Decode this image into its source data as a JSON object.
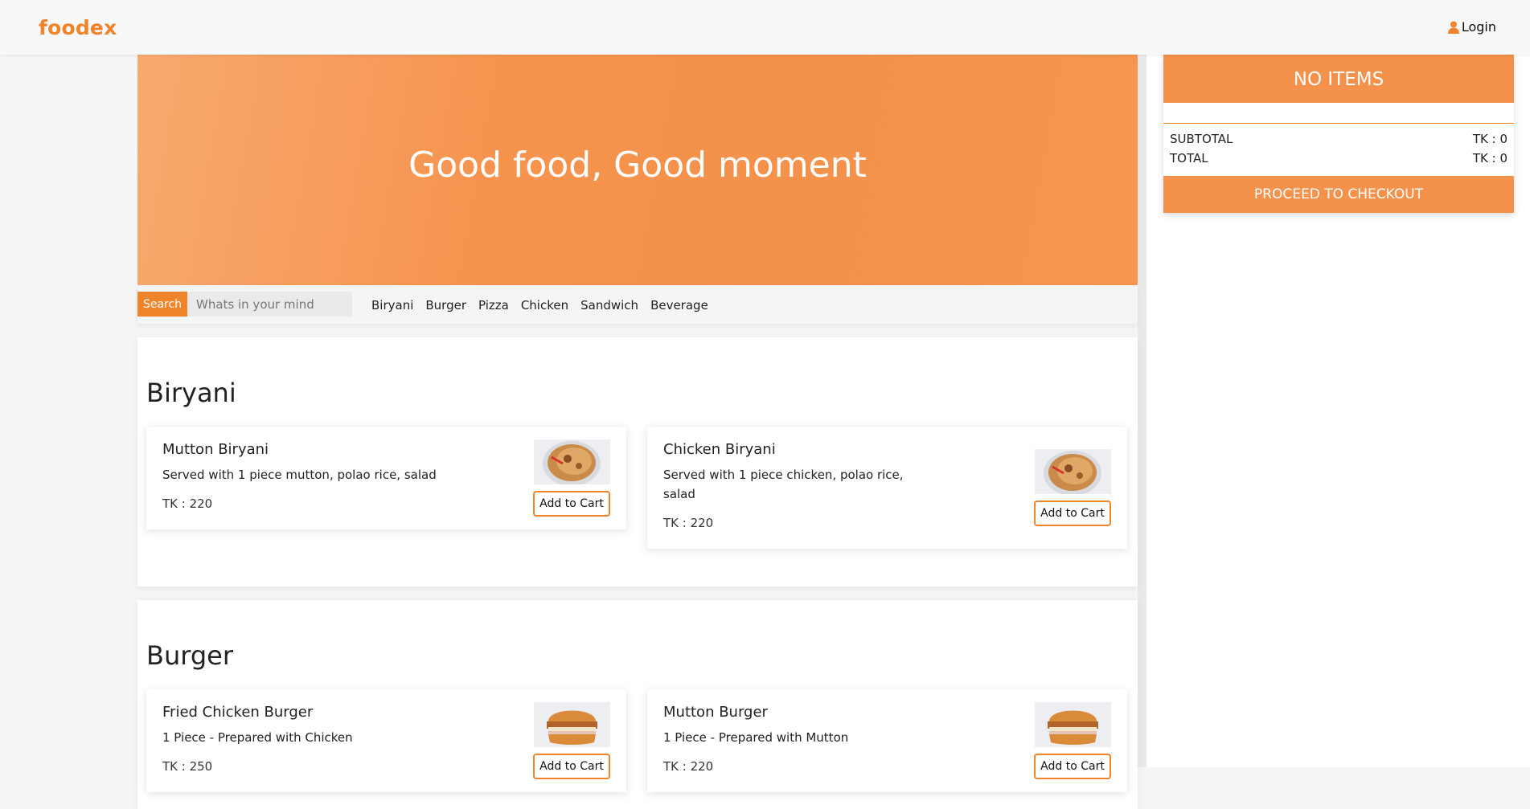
{
  "brand": {
    "logo": "foodex",
    "accent": "#f0842a"
  },
  "nav": {
    "login_label": "Login",
    "login_icon": "user-icon"
  },
  "hero": {
    "title": "Good food, Good moment"
  },
  "search": {
    "button_label": "Search",
    "placeholder": "Whats in your mind",
    "value": "",
    "categories": [
      "Biryani",
      "Burger",
      "Pizza",
      "Chicken",
      "Sandwich",
      "Beverage"
    ]
  },
  "sections": [
    {
      "title": "Biryani",
      "items": [
        {
          "name": "Mutton Biryani",
          "description": "Served with 1 piece mutton, polao rice, salad",
          "price": "TK : 220",
          "button": "Add to Cart",
          "image": "biryani-plate"
        },
        {
          "name": "Chicken Biryani",
          "description": "Served with 1 piece chicken, polao rice, salad",
          "price": "TK : 220",
          "button": "Add to Cart",
          "image": "biryani-plate"
        }
      ]
    },
    {
      "title": "Burger",
      "items": [
        {
          "name": "Fried Chicken Burger",
          "description": "1 Piece - Prepared with Chicken",
          "price": "TK : 250",
          "button": "Add to Cart",
          "image": "burger"
        },
        {
          "name": "Mutton Burger",
          "description": "1 Piece - Prepared with Mutton",
          "price": "TK : 220",
          "button": "Add to Cart",
          "image": "burger"
        }
      ]
    }
  ],
  "cart": {
    "header": "NO ITEMS",
    "subtotal_label": "SUBTOTAL",
    "subtotal_value": "TK : 0",
    "total_label": "TOTAL",
    "total_value": "TK : 0",
    "checkout_label": "PROCEED TO CHECKOUT"
  }
}
